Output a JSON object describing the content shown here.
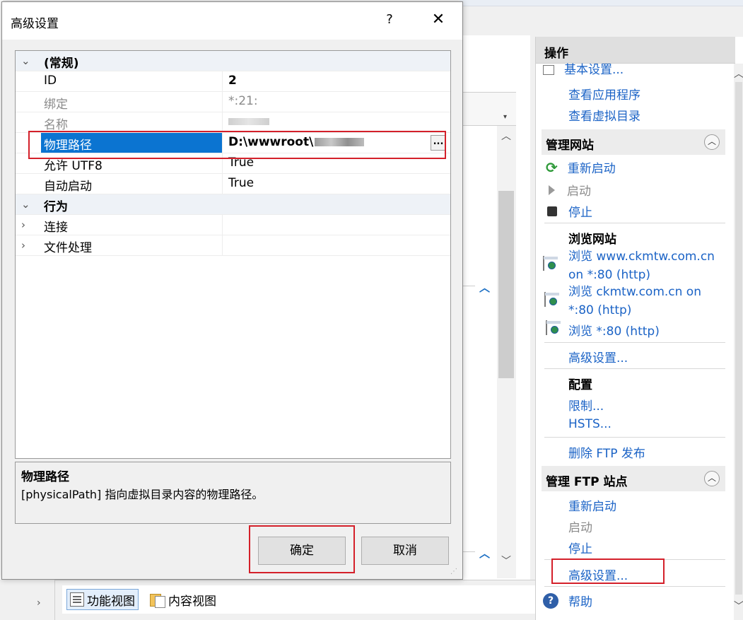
{
  "dialog": {
    "title": "高级设置",
    "help_symbol": "?",
    "close_symbol": "✕",
    "properties": [
      {
        "kind": "category",
        "expander": "⌄",
        "name": "(常规)"
      },
      {
        "kind": "prop",
        "name": "ID",
        "value": "2",
        "bold": true
      },
      {
        "kind": "prop",
        "name": "绑定",
        "value": "*:21:",
        "readonly": true
      },
      {
        "kind": "prop",
        "name": "名称",
        "value": "",
        "readonly": true,
        "redacted": true
      },
      {
        "kind": "prop",
        "name": "物理路径",
        "value": "D:\\wwwroot\\",
        "selected": true,
        "redacted": true,
        "button_label": "..."
      },
      {
        "kind": "prop",
        "name": "允许 UTF8",
        "value": "True"
      },
      {
        "kind": "prop",
        "name": "自动启动",
        "value": "True"
      },
      {
        "kind": "category",
        "expander": "⌄",
        "name": "行为"
      },
      {
        "kind": "group",
        "expander": "›",
        "name": "连接"
      },
      {
        "kind": "group",
        "expander": "›",
        "name": "文件处理"
      }
    ],
    "description": {
      "title": "物理路径",
      "text": "[physicalPath] 指向虚拟目录内容的物理路径。"
    },
    "ok_label": "确定",
    "cancel_label": "取消"
  },
  "actions": {
    "header": "操作",
    "top_items": [
      {
        "label": "基本设置...",
        "type": "link"
      },
      {
        "label": "查看应用程序",
        "type": "link"
      },
      {
        "label": "查看虚拟目录",
        "type": "link"
      }
    ],
    "manage_site": {
      "title": "管理网站",
      "restart": "重新启动",
      "start": "启动",
      "stop": "停止",
      "browse_title": "浏览网站",
      "browse1_line1": "浏览 www.ckmtw.com.cn",
      "browse1_line2": "on *:80 (http)",
      "browse2_line1": "浏览 ckmtw.com.cn on",
      "browse2_line2": "*:80 (http)",
      "browse3": "浏览 *:80 (http)",
      "advanced": "高级设置...",
      "config_title": "配置",
      "limits": "限制...",
      "hsts": "HSTS...",
      "remove_ftp": "删除 FTP 发布"
    },
    "manage_ftp": {
      "title": "管理 FTP 站点",
      "restart": "重新启动",
      "start": "启动",
      "stop": "停止",
      "advanced": "高级设置..."
    },
    "help": "帮助"
  },
  "bottom": {
    "features_view": "功能视图",
    "content_view": "内容视图"
  },
  "colors": {
    "accent": "#0b74d1",
    "link": "#1b63c6",
    "highlight_box": "#d4202a"
  }
}
